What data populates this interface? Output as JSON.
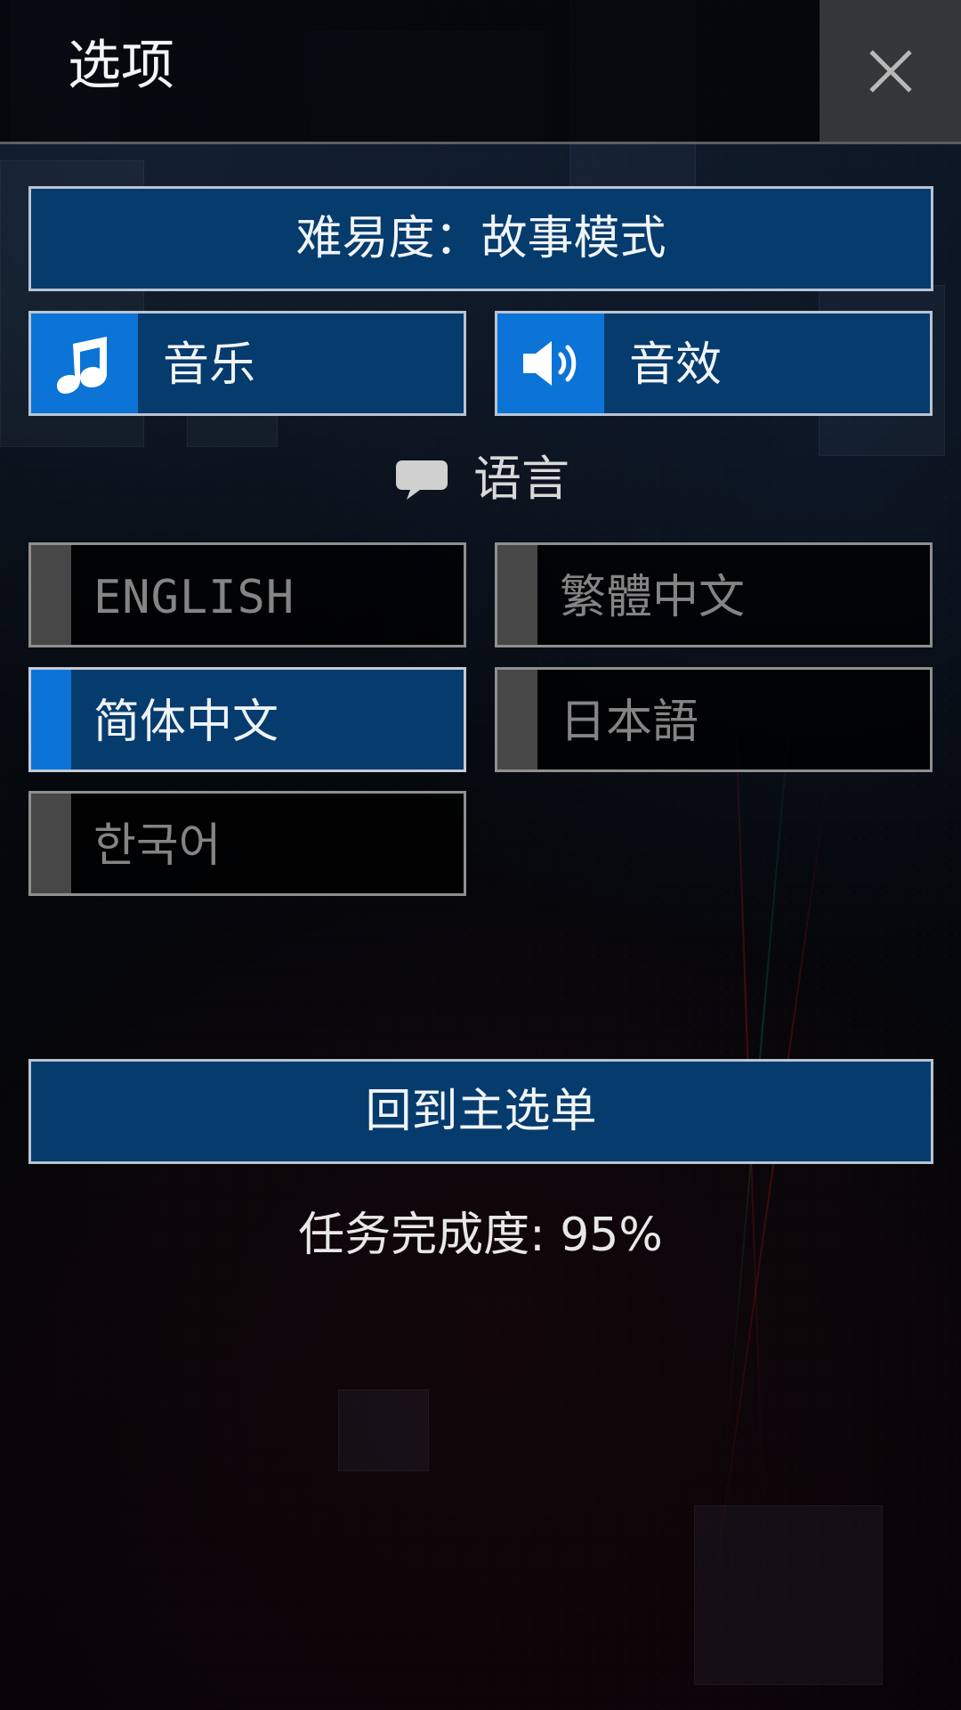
{
  "header": {
    "title": "选项"
  },
  "menu": {
    "difficulty_label": "难易度：故事模式",
    "music_label": "音乐",
    "sfx_label": "音效",
    "language_label": "语言",
    "return_label": "回到主选单"
  },
  "languages": [
    {
      "label": "ENGLISH",
      "selected": false
    },
    {
      "label": "繁體中文",
      "selected": false
    },
    {
      "label": "简体中文",
      "selected": true
    },
    {
      "label": "日本語",
      "selected": false
    },
    {
      "label": "한국어",
      "selected": false
    }
  ],
  "status": {
    "completion_text": "任务完成度: 95%"
  },
  "icons": {
    "close": "close-icon",
    "music": "music-note-icon",
    "sfx": "speaker-icon",
    "language": "speech-bubble-icon"
  },
  "colors": {
    "primary_blue": "#063b6d",
    "accent_blue": "#0b74d6",
    "inactive_gray": "#474747",
    "text_light": "#f1f4f7",
    "text_muted": "#848484"
  }
}
